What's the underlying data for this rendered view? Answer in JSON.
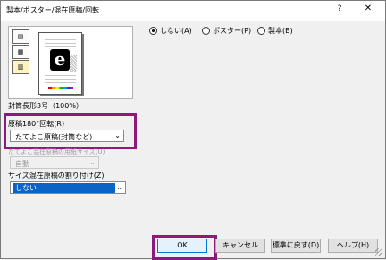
{
  "window": {
    "title": "製本/ポスター/混在原稿/回転",
    "help_glyph": "?",
    "close_glyph": "✕"
  },
  "preview": {
    "icons": [
      "book-mode-icon",
      "poster-mode-icon",
      "stack-mode-icon"
    ],
    "paper_glyph": "e",
    "caption": "封筒長形3号（100%）"
  },
  "rotate": {
    "label": "原稿180°回転(R)",
    "value": "たてよこ原稿(封筒など)"
  },
  "disabled_field": {
    "label": "たてよこ混在原稿の用紙サイズ(U)",
    "value": "自動"
  },
  "mixed_size": {
    "label": "サイズ混在原稿の割り付け(Z)",
    "value": "しない"
  },
  "layout_radios": [
    {
      "label": "しない(A)",
      "checked": true
    },
    {
      "label": "ポスター(P)",
      "checked": false
    },
    {
      "label": "製本(B)",
      "checked": false
    }
  ],
  "buttons": {
    "ok": "OK",
    "cancel": "キャンセル",
    "reset": "標準に戻す(D)",
    "help": "ヘルプ(H)"
  },
  "colors": {
    "highlight": "#8c1a7a",
    "selection": "#0a64c8"
  }
}
